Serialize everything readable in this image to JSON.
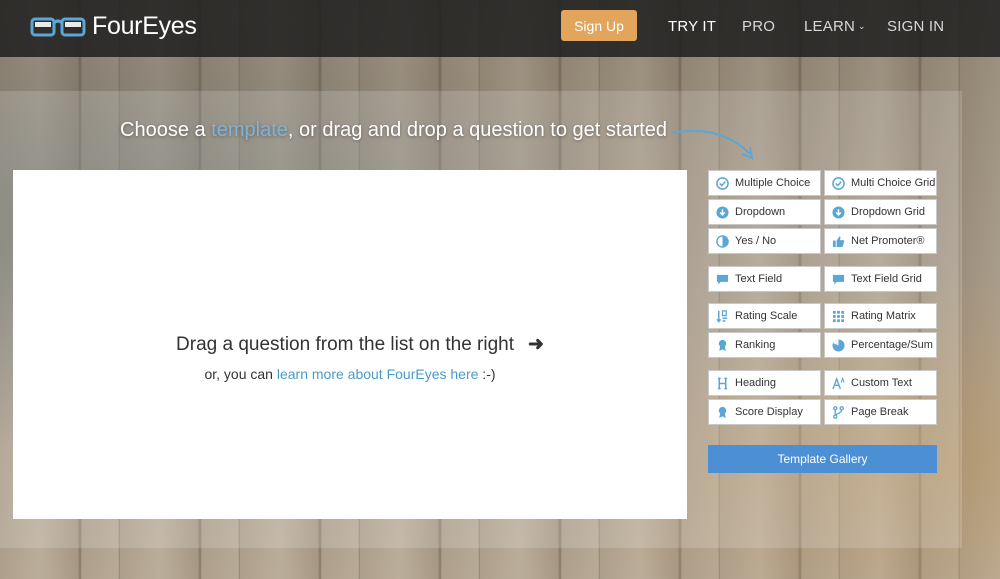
{
  "brand": {
    "name": "FourEyes",
    "accent": "#5aa6d6"
  },
  "nav": {
    "signup": "Sign Up",
    "tryit": "TRY IT",
    "pro": "PRO",
    "learn": "LEARN",
    "signin": "SIGN IN"
  },
  "headline": {
    "prefix": "Choose a ",
    "link": "template",
    "suffix": ", or drag and drop a question to get started"
  },
  "canvas": {
    "drag_text": "Drag a question from the list on the right",
    "sub_prefix": "or, you can ",
    "sub_link": "learn more about FourEyes here",
    "sub_suffix": " :-)"
  },
  "questions": {
    "multiple_choice": "Multiple Choice",
    "multi_choice_grid": "Multi Choice Grid",
    "dropdown": "Dropdown",
    "dropdown_grid": "Dropdown Grid",
    "yes_no": "Yes / No",
    "net_promoter": "Net Promoter®",
    "text_field": "Text Field",
    "text_field_grid": "Text Field Grid",
    "rating_scale": "Rating Scale",
    "rating_matrix": "Rating Matrix",
    "ranking": "Ranking",
    "percentage_sum": "Percentage/Sum",
    "heading": "Heading",
    "custom_text": "Custom Text",
    "score_display": "Score Display",
    "page_break": "Page Break"
  },
  "template_gallery": "Template Gallery",
  "colors": {
    "icon": "#5aa6d6",
    "signup": "#e3a45b",
    "gallery": "#4d8fd4"
  }
}
